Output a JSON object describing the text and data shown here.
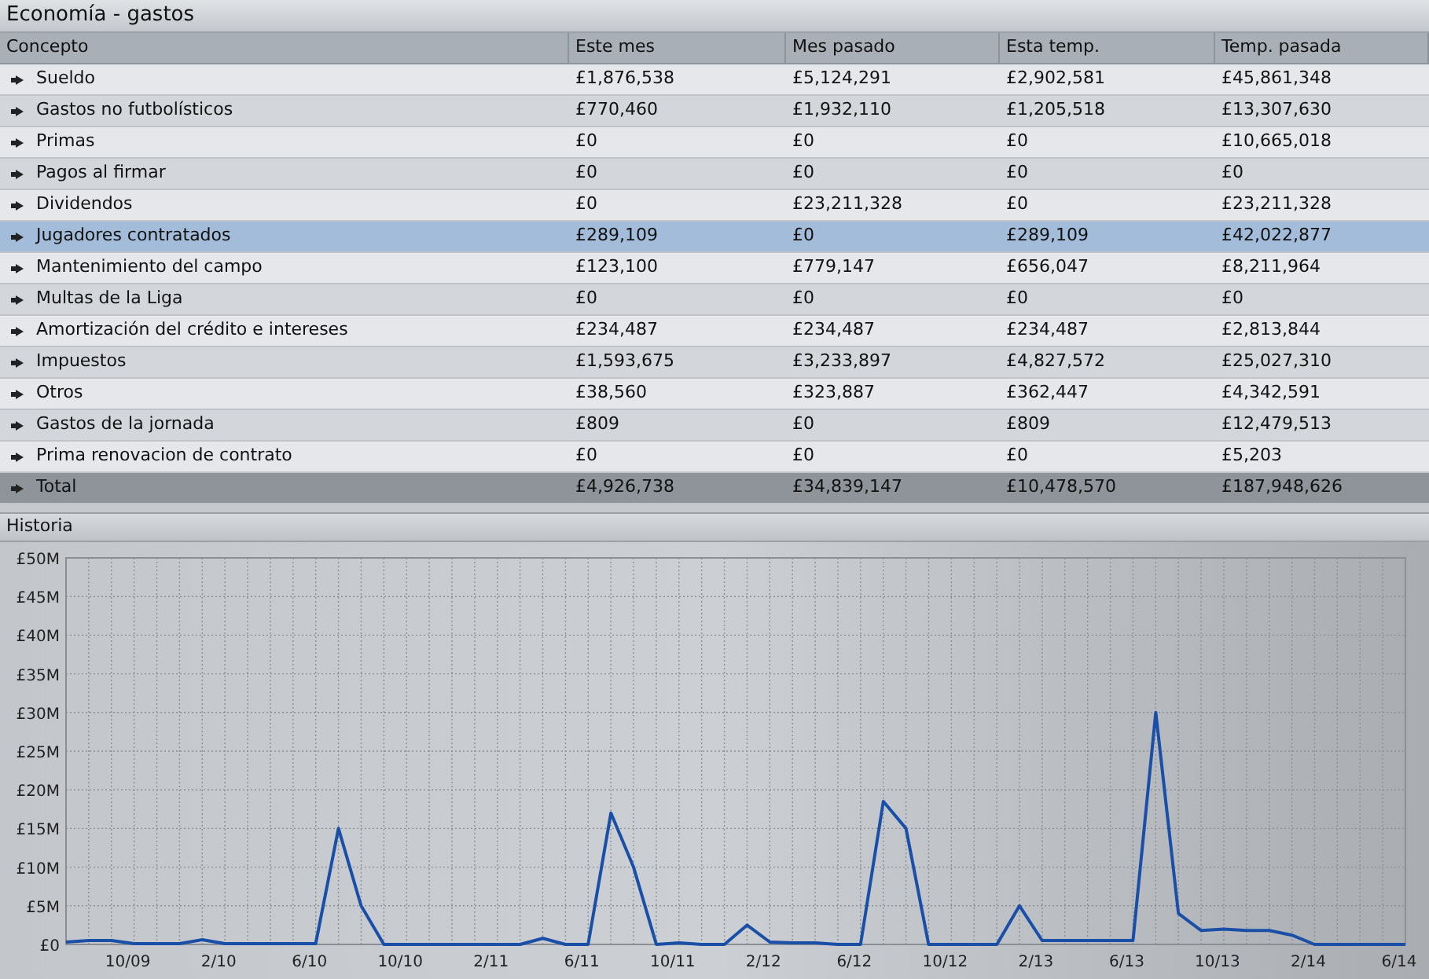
{
  "window": {
    "title": "Economía - gastos"
  },
  "table": {
    "columns": [
      "Concepto",
      "Este mes",
      "Mes pasado",
      "Esta temp.",
      "Temp. pasada"
    ],
    "rows": [
      {
        "kind": "item",
        "selected": false,
        "cells": [
          "Sueldo",
          "£1,876,538",
          "£5,124,291",
          "£2,902,581",
          "£45,861,348"
        ]
      },
      {
        "kind": "item",
        "selected": false,
        "cells": [
          "Gastos no futbolísticos",
          "£770,460",
          "£1,932,110",
          "£1,205,518",
          "£13,307,630"
        ]
      },
      {
        "kind": "item",
        "selected": false,
        "cells": [
          "Primas",
          "£0",
          "£0",
          "£0",
          "£10,665,018"
        ]
      },
      {
        "kind": "item",
        "selected": false,
        "cells": [
          "Pagos al firmar",
          "£0",
          "£0",
          "£0",
          "£0"
        ]
      },
      {
        "kind": "item",
        "selected": false,
        "cells": [
          "Dividendos",
          "£0",
          "£23,211,328",
          "£0",
          "£23,211,328"
        ]
      },
      {
        "kind": "item",
        "selected": true,
        "cells": [
          "Jugadores contratados",
          "£289,109",
          "£0",
          "£289,109",
          "£42,022,877"
        ]
      },
      {
        "kind": "item",
        "selected": false,
        "cells": [
          "Mantenimiento del campo",
          "£123,100",
          "£779,147",
          "£656,047",
          "£8,211,964"
        ]
      },
      {
        "kind": "item",
        "selected": false,
        "cells": [
          "Multas de la Liga",
          "£0",
          "£0",
          "£0",
          "£0"
        ]
      },
      {
        "kind": "item",
        "selected": false,
        "cells": [
          "Amortización del crédito e intereses",
          "£234,487",
          "£234,487",
          "£234,487",
          "£2,813,844"
        ]
      },
      {
        "kind": "item",
        "selected": false,
        "cells": [
          "Impuestos",
          "£1,593,675",
          "£3,233,897",
          "£4,827,572",
          "£25,027,310"
        ]
      },
      {
        "kind": "item",
        "selected": false,
        "cells": [
          "Otros",
          "£38,560",
          "£323,887",
          "£362,447",
          "£4,342,591"
        ]
      },
      {
        "kind": "item",
        "selected": false,
        "cells": [
          "Gastos de la jornada",
          "£809",
          "£0",
          "£809",
          "£12,479,513"
        ]
      },
      {
        "kind": "item",
        "selected": false,
        "cells": [
          "Prima renovacion de contrato",
          "£0",
          "£0",
          "£0",
          "£5,203"
        ]
      },
      {
        "kind": "total",
        "selected": false,
        "cells": [
          "Total",
          "£4,926,738",
          "£34,839,147",
          "£10,478,570",
          "£187,948,626"
        ]
      }
    ]
  },
  "history": {
    "title": "Historia",
    "chart_data": {
      "type": "line",
      "categories": [
        null,
        null,
        null,
        "10/09",
        null,
        null,
        null,
        "2/10",
        null,
        null,
        null,
        "6/10",
        null,
        null,
        null,
        "10/10",
        null,
        null,
        null,
        "2/11",
        null,
        null,
        null,
        "6/11",
        null,
        null,
        null,
        "10/11",
        null,
        null,
        null,
        "2/12",
        null,
        null,
        null,
        "6/12",
        null,
        null,
        null,
        "10/12",
        null,
        null,
        null,
        "2/13",
        null,
        null,
        null,
        "6/13",
        null,
        null,
        null,
        "10/13",
        null,
        null,
        null,
        "2/14",
        null,
        null,
        null,
        "6/14"
      ],
      "series": [
        {
          "color": "#1a4fa8",
          "values": [
            0.3,
            0.5,
            0.5,
            0.1,
            0.1,
            0.1,
            0.6,
            0.1,
            0.1,
            0.1,
            0.1,
            0.1,
            15,
            5,
            0,
            0,
            0,
            0,
            0,
            0,
            0,
            0.8,
            0,
            0,
            17,
            10,
            0,
            0.2,
            0,
            0,
            2.5,
            0.3,
            0.2,
            0.2,
            0,
            0,
            18.5,
            15,
            0,
            0,
            0,
            0,
            5,
            0.5,
            0.5,
            0.5,
            0.5,
            0.5,
            30,
            4,
            1.8,
            2,
            1.8,
            1.8,
            1.2,
            0,
            0,
            0,
            0,
            0
          ]
        }
      ],
      "ylim": [
        0,
        50
      ],
      "grid": true,
      "yticks": [
        {
          "value": 0,
          "label": "£0"
        },
        {
          "value": 5,
          "label": "£5M"
        },
        {
          "value": 10,
          "label": "£10M"
        },
        {
          "value": 15,
          "label": "£15M"
        },
        {
          "value": 20,
          "label": "£20M"
        },
        {
          "value": 25,
          "label": "£25M"
        },
        {
          "value": 30,
          "label": "£30M"
        },
        {
          "value": 35,
          "label": "£35M"
        },
        {
          "value": 40,
          "label": "£40M"
        },
        {
          "value": 45,
          "label": "£45M"
        },
        {
          "value": 50,
          "label": "£50M"
        }
      ]
    }
  }
}
